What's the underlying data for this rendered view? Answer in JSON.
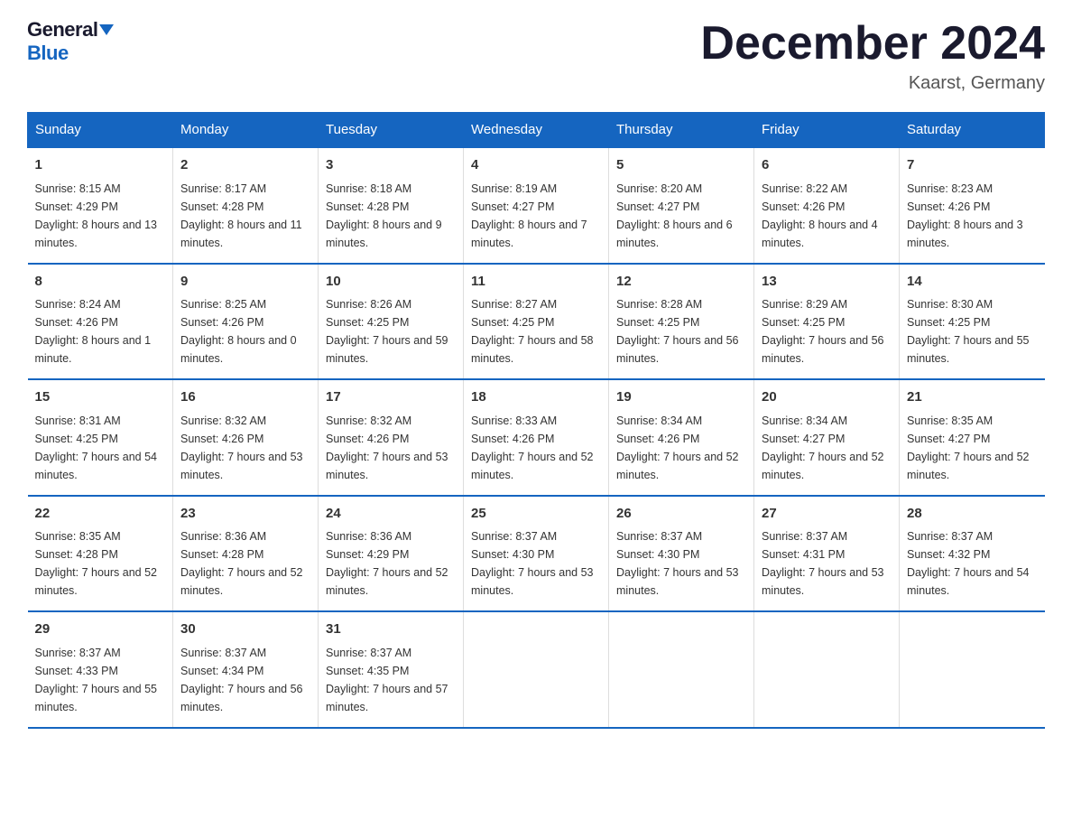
{
  "header": {
    "logo_general": "General",
    "logo_blue": "Blue",
    "month_title": "December 2024",
    "location": "Kaarst, Germany"
  },
  "days_of_week": [
    "Sunday",
    "Monday",
    "Tuesday",
    "Wednesday",
    "Thursday",
    "Friday",
    "Saturday"
  ],
  "weeks": [
    [
      {
        "num": "1",
        "sunrise": "8:15 AM",
        "sunset": "4:29 PM",
        "daylight": "8 hours and 13 minutes."
      },
      {
        "num": "2",
        "sunrise": "8:17 AM",
        "sunset": "4:28 PM",
        "daylight": "8 hours and 11 minutes."
      },
      {
        "num": "3",
        "sunrise": "8:18 AM",
        "sunset": "4:28 PM",
        "daylight": "8 hours and 9 minutes."
      },
      {
        "num": "4",
        "sunrise": "8:19 AM",
        "sunset": "4:27 PM",
        "daylight": "8 hours and 7 minutes."
      },
      {
        "num": "5",
        "sunrise": "8:20 AM",
        "sunset": "4:27 PM",
        "daylight": "8 hours and 6 minutes."
      },
      {
        "num": "6",
        "sunrise": "8:22 AM",
        "sunset": "4:26 PM",
        "daylight": "8 hours and 4 minutes."
      },
      {
        "num": "7",
        "sunrise": "8:23 AM",
        "sunset": "4:26 PM",
        "daylight": "8 hours and 3 minutes."
      }
    ],
    [
      {
        "num": "8",
        "sunrise": "8:24 AM",
        "sunset": "4:26 PM",
        "daylight": "8 hours and 1 minute."
      },
      {
        "num": "9",
        "sunrise": "8:25 AM",
        "sunset": "4:26 PM",
        "daylight": "8 hours and 0 minutes."
      },
      {
        "num": "10",
        "sunrise": "8:26 AM",
        "sunset": "4:25 PM",
        "daylight": "7 hours and 59 minutes."
      },
      {
        "num": "11",
        "sunrise": "8:27 AM",
        "sunset": "4:25 PM",
        "daylight": "7 hours and 58 minutes."
      },
      {
        "num": "12",
        "sunrise": "8:28 AM",
        "sunset": "4:25 PM",
        "daylight": "7 hours and 56 minutes."
      },
      {
        "num": "13",
        "sunrise": "8:29 AM",
        "sunset": "4:25 PM",
        "daylight": "7 hours and 56 minutes."
      },
      {
        "num": "14",
        "sunrise": "8:30 AM",
        "sunset": "4:25 PM",
        "daylight": "7 hours and 55 minutes."
      }
    ],
    [
      {
        "num": "15",
        "sunrise": "8:31 AM",
        "sunset": "4:25 PM",
        "daylight": "7 hours and 54 minutes."
      },
      {
        "num": "16",
        "sunrise": "8:32 AM",
        "sunset": "4:26 PM",
        "daylight": "7 hours and 53 minutes."
      },
      {
        "num": "17",
        "sunrise": "8:32 AM",
        "sunset": "4:26 PM",
        "daylight": "7 hours and 53 minutes."
      },
      {
        "num": "18",
        "sunrise": "8:33 AM",
        "sunset": "4:26 PM",
        "daylight": "7 hours and 52 minutes."
      },
      {
        "num": "19",
        "sunrise": "8:34 AM",
        "sunset": "4:26 PM",
        "daylight": "7 hours and 52 minutes."
      },
      {
        "num": "20",
        "sunrise": "8:34 AM",
        "sunset": "4:27 PM",
        "daylight": "7 hours and 52 minutes."
      },
      {
        "num": "21",
        "sunrise": "8:35 AM",
        "sunset": "4:27 PM",
        "daylight": "7 hours and 52 minutes."
      }
    ],
    [
      {
        "num": "22",
        "sunrise": "8:35 AM",
        "sunset": "4:28 PM",
        "daylight": "7 hours and 52 minutes."
      },
      {
        "num": "23",
        "sunrise": "8:36 AM",
        "sunset": "4:28 PM",
        "daylight": "7 hours and 52 minutes."
      },
      {
        "num": "24",
        "sunrise": "8:36 AM",
        "sunset": "4:29 PM",
        "daylight": "7 hours and 52 minutes."
      },
      {
        "num": "25",
        "sunrise": "8:37 AM",
        "sunset": "4:30 PM",
        "daylight": "7 hours and 53 minutes."
      },
      {
        "num": "26",
        "sunrise": "8:37 AM",
        "sunset": "4:30 PM",
        "daylight": "7 hours and 53 minutes."
      },
      {
        "num": "27",
        "sunrise": "8:37 AM",
        "sunset": "4:31 PM",
        "daylight": "7 hours and 53 minutes."
      },
      {
        "num": "28",
        "sunrise": "8:37 AM",
        "sunset": "4:32 PM",
        "daylight": "7 hours and 54 minutes."
      }
    ],
    [
      {
        "num": "29",
        "sunrise": "8:37 AM",
        "sunset": "4:33 PM",
        "daylight": "7 hours and 55 minutes."
      },
      {
        "num": "30",
        "sunrise": "8:37 AM",
        "sunset": "4:34 PM",
        "daylight": "7 hours and 56 minutes."
      },
      {
        "num": "31",
        "sunrise": "8:37 AM",
        "sunset": "4:35 PM",
        "daylight": "7 hours and 57 minutes."
      },
      null,
      null,
      null,
      null
    ]
  ],
  "labels": {
    "sunrise": "Sunrise:",
    "sunset": "Sunset:",
    "daylight": "Daylight:"
  }
}
